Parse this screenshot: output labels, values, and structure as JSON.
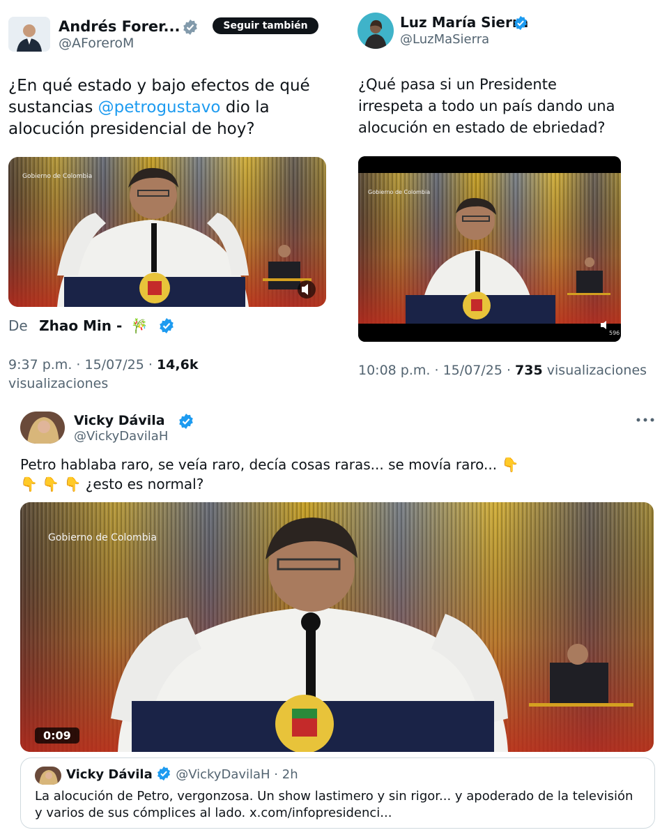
{
  "tweet1": {
    "name": "Andrés Forer...",
    "handle": "@AForeroM",
    "follow_label": "Seguir también",
    "text_before": "¿En qué estado y bajo efectos de qué sustancias ",
    "mention": "@petrogustavo",
    "text_after": " dio la alocución presidencial de hoy?",
    "video_watermark": "Gobierno de Colombia",
    "from_label": "De",
    "from_name": "Zhao Min -",
    "from_emoji": "🎋",
    "time": "9:37 p.m.",
    "date": "15/07/25",
    "views": "14,6k",
    "views_label": "visualizaciones"
  },
  "tweet2": {
    "name": "Luz María Sierra",
    "handle": "@LuzMaSierra",
    "text": "¿Qué pasa si un Presidente irrespeta a todo un país dando una alocución en estado de ebriedad?",
    "video_watermark": "Gobierno de Colombia",
    "video_counter": "596",
    "time": "10:08 p.m.",
    "date": "15/07/25",
    "views": "735",
    "views_label": "visualizaciones"
  },
  "tweet3": {
    "name": "Vicky Dávila",
    "handle": "@VickyDavilaH",
    "more_icon": "more-horizontal-icon",
    "text_line1": "Petro hablaba raro, se veía raro, decía cosas raras... se movía raro...",
    "text_line2": "¿esto es normal?",
    "emoji": "👇",
    "video_watermark": "Gobierno de Colombia",
    "duration": "0:09",
    "quote": {
      "name": "Vicky Dávila",
      "handle": "@VickyDavilaH",
      "age": "2h",
      "text": "La alocución de Petro, vergonzosa. Un show lastimero y sin rigor... y apoderado de la televisión y varios de sus cómplices al lado. x.com/infopresidenci..."
    }
  },
  "colors": {
    "accent": "#1d9bf0",
    "verified": "#1d9bf0",
    "verified_gray": "#829aab",
    "text": "#0f1419",
    "muted": "#536471"
  }
}
